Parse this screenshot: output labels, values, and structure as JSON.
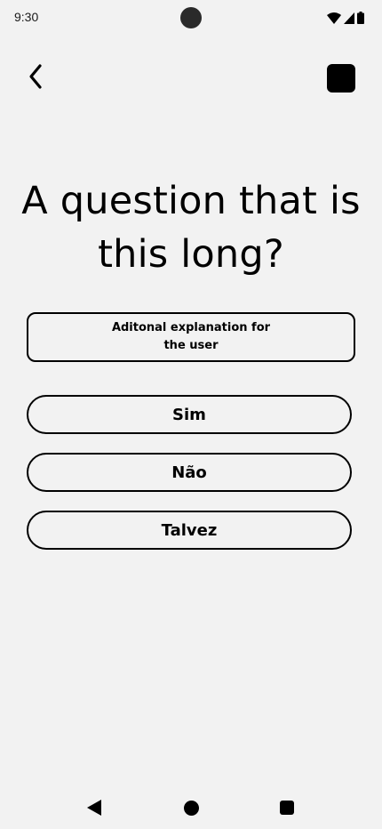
{
  "status_bar": {
    "time": "9:30",
    "icons": [
      "wifi-icon",
      "cellular-signal-icon",
      "battery-icon"
    ]
  },
  "top_bar": {
    "back_icon": "chevron-left-icon",
    "action_icon": "square-icon"
  },
  "question": {
    "title": "A question that is this long?",
    "explanation": "Aditonal explanation for the user"
  },
  "answers": [
    {
      "label": "Sim"
    },
    {
      "label": "Não"
    },
    {
      "label": "Talvez"
    }
  ],
  "nav_bar": {
    "icons": [
      "back-triangle-icon",
      "home-circle-icon",
      "recents-square-icon"
    ]
  },
  "colors": {
    "background": "#f2f2f2",
    "foreground": "#000000"
  }
}
